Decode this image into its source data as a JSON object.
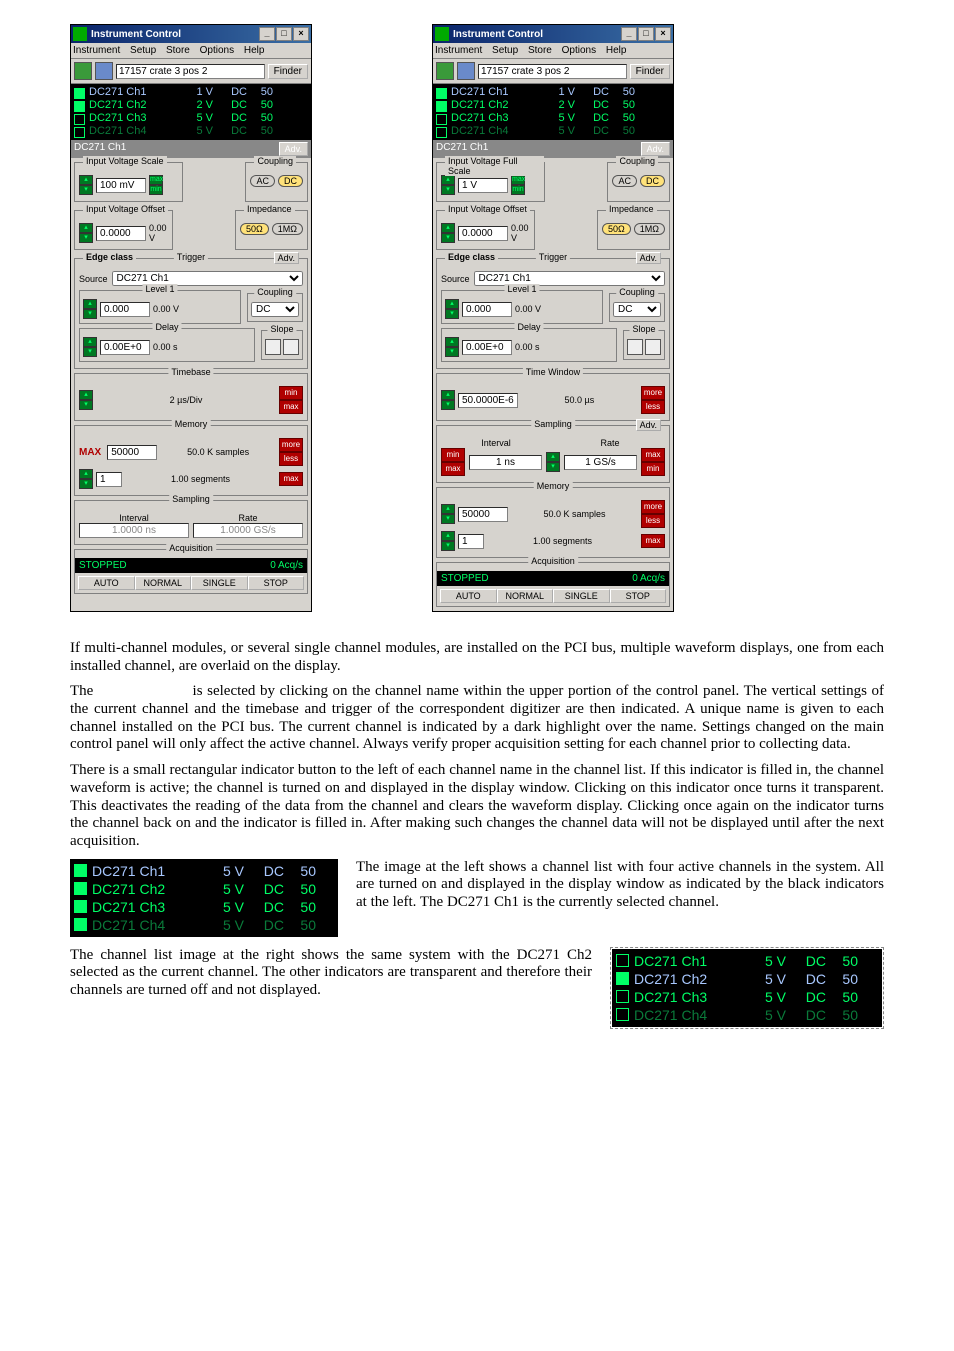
{
  "panel": {
    "title": "Instrument Control",
    "menus": [
      "Instrument",
      "Setup",
      "Store",
      "Options",
      "Help"
    ],
    "device": "17157 crate 3 pos 2",
    "finder": "Finder",
    "channels": [
      {
        "name": "DC271 Ch1",
        "volt": "1 V",
        "coup": "DC",
        "ohm": "50"
      },
      {
        "name": "DC271 Ch2",
        "volt": "2 V",
        "coup": "DC",
        "ohm": "50"
      },
      {
        "name": "DC271 Ch3",
        "volt": "5 V",
        "coup": "DC",
        "ohm": "50"
      },
      {
        "name": "DC271 Ch4",
        "volt": "5 V",
        "coup": "DC",
        "ohm": "50"
      }
    ],
    "selected": "DC271 Ch1",
    "adv": "Adv.",
    "groups": {
      "ivs": "Input Voltage Scale",
      "ivsfull": "Input Voltage Full Scale",
      "ivs_val_a": "100 mV",
      "ivs_val_b": "1 V",
      "max": "max",
      "min": "min",
      "coupling": "Coupling",
      "ac": "AC",
      "dc": "DC",
      "ivo": "Input Voltage Offset",
      "ivo_val": "0.0000",
      "ivo_disp": "0.00 V",
      "imp": "Impedance",
      "fifty": "50Ω",
      "oneM": "1MΩ",
      "edge": "Edge class",
      "trigger": "Trigger",
      "source_l": "Source",
      "source_v": "DC271 Ch1",
      "level": "Level 1",
      "lvl_val": "0.000",
      "lvl_disp": "0.00 V",
      "lvl_cpl": "DC",
      "delay": "Delay",
      "del_val": "0.00E+0",
      "del_disp": "0.00 s",
      "slope": "Slope",
      "timebase": "Timebase",
      "tb_val": "2 µs/Div",
      "tw": "Time Window",
      "tw_val": "50.0000E-6",
      "tw_disp": "50.0 µs",
      "memory": "Memory",
      "mem_max": "MAX",
      "mem_val": "50000",
      "mem_disp": "50.0 K  samples",
      "seg_val": "1",
      "seg_disp": "1.00   segments",
      "sampling": "Sampling",
      "interval": "Interval",
      "rate": "Rate",
      "intv_a": "1.0000 ns",
      "rate_a": "1.0000 GS/s",
      "intv_b": "1 ns",
      "rate_b": "1 GS/s",
      "more": "more",
      "less": "less",
      "max2": "max",
      "min2": "min",
      "acq": "Acquisition",
      "stopped": "STOPPED",
      "zero": "0 Acq/s",
      "btns": [
        "AUTO",
        "NORMAL",
        "SINGLE",
        "STOP"
      ]
    }
  },
  "paras": {
    "p1": "If multi-channel modules, or several single channel modules, are installed on the PCI bus, multiple waveform displays, one from each installed channel, are overlaid on the display.",
    "p2a": "The ",
    "p2b": " is selected by clicking on the channel name within the upper portion of the control panel. The vertical settings of the current channel and the timebase and trigger of the correspondent digitizer are then indicated. A unique name is given to each channel installed on the PCI bus. The current channel is indicated by a dark highlight over the name. Settings changed on the main control panel will only affect the active channel. Always verify proper acquisition setting for each channel prior to collecting data.",
    "p3": "There is a small rectangular indicator button to the left of each channel name in the channel list. If this indicator is filled in, the channel waveform is active; the channel is turned on and displayed in the display window. Clicking on this indicator once turns it transparent. This deactivates the reading of the data from the channel and clears the waveform display. Clicking once again on the indicator turns the channel back on and the indicator is filled in. After making such changes the channel data will not be displayed until after the next acquisition.",
    "p4": "The image at the left shows a channel list with four active channels in the system. All are turned on and displayed in the display window as indicated by the black indicators at the left. The DC271 Ch1 is the currently selected channel.",
    "p5": "The channel list image at the right shows the same system with the DC271 Ch2 selected as the current channel. The other indicators are transparent and therefore their channels are turned off and not displayed."
  },
  "bigchan": {
    "left": [
      {
        "name": "DC271 Ch1",
        "v": "5 V",
        "c": "DC",
        "o": "50",
        "fill": true,
        "cls": "sel"
      },
      {
        "name": "DC271 Ch2",
        "v": "5 V",
        "c": "DC",
        "o": "50",
        "fill": true,
        "cls": "brt"
      },
      {
        "name": "DC271 Ch3",
        "v": "5 V",
        "c": "DC",
        "o": "50",
        "fill": true,
        "cls": "brt"
      },
      {
        "name": "DC271 Ch4",
        "v": "5 V",
        "c": "DC",
        "o": "50",
        "fill": true,
        "cls": "dim"
      }
    ],
    "right": [
      {
        "name": "DC271 Ch1",
        "v": "5 V",
        "c": "DC",
        "o": "50",
        "fill": false,
        "cls": "brt"
      },
      {
        "name": "DC271 Ch2",
        "v": "5 V",
        "c": "DC",
        "o": "50",
        "fill": true,
        "cls": "sel"
      },
      {
        "name": "DC271 Ch3",
        "v": "5 V",
        "c": "DC",
        "o": "50",
        "fill": false,
        "cls": "brt"
      },
      {
        "name": "DC271 Ch4",
        "v": "5 V",
        "c": "DC",
        "o": "50",
        "fill": false,
        "cls": "dim"
      }
    ]
  }
}
